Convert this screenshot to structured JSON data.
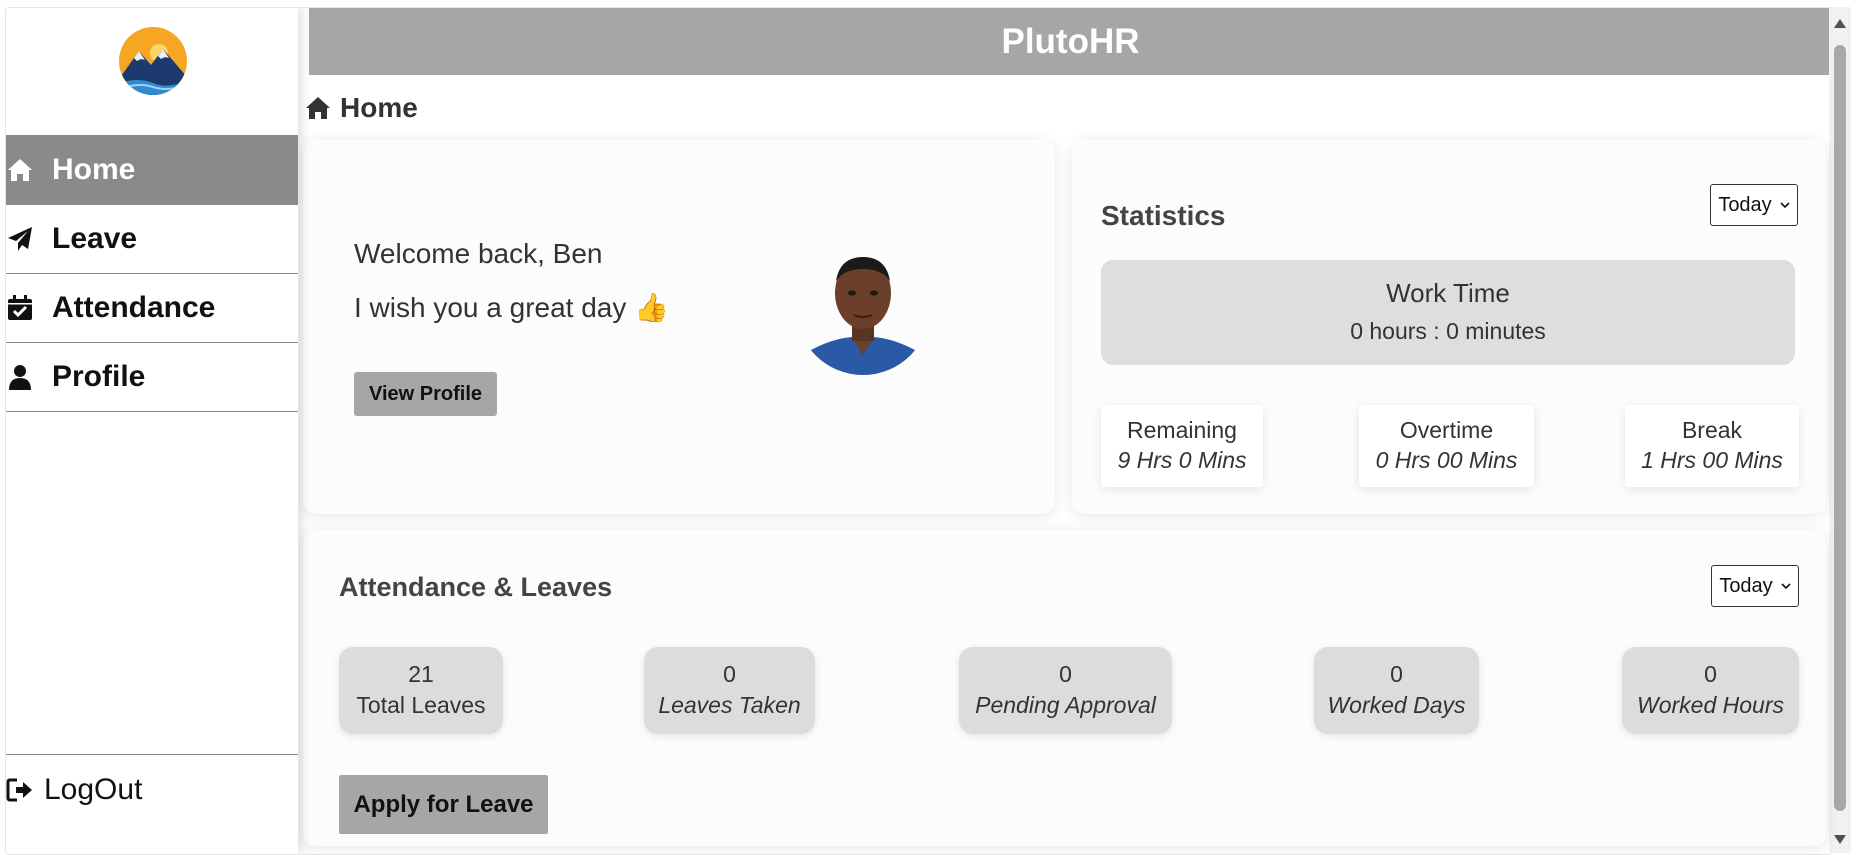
{
  "app": {
    "title": "PlutoHR"
  },
  "sidebar": {
    "items": [
      {
        "label": "Home",
        "icon": "home-icon",
        "active": true
      },
      {
        "label": "Leave",
        "icon": "paper-plane-icon",
        "active": false
      },
      {
        "label": "Attendance",
        "icon": "calendar-check-icon",
        "active": false
      },
      {
        "label": "Profile",
        "icon": "user-icon",
        "active": false
      }
    ],
    "logout_label": "LogOut"
  },
  "breadcrumb": {
    "label": "Home"
  },
  "welcome": {
    "greeting": "Welcome back, Ben",
    "wish": "I wish you a great day 👍",
    "view_profile_label": "View Profile"
  },
  "statistics": {
    "title": "Statistics",
    "period": "Today",
    "work_time_label": "Work Time",
    "work_time_value": "0 hours : 0 minutes",
    "remaining_label": "Remaining",
    "remaining_value": "9 Hrs 0 Mins",
    "overtime_label": "Overtime",
    "overtime_value": "0 Hrs 00 Mins",
    "break_label": "Break",
    "break_value": "1 Hrs 00 Mins"
  },
  "attendance": {
    "title": "Attendance & Leaves",
    "period": "Today",
    "total_leaves_value": "21",
    "total_leaves_label": "Total Leaves",
    "leaves_taken_value": "0",
    "leaves_taken_label": "Leaves Taken",
    "pending_value": "0",
    "pending_label": "Pending Approval",
    "worked_days_value": "0",
    "worked_days_label": "Worked Days",
    "worked_hours_value": "0",
    "worked_hours_label": "Worked Hours",
    "apply_label": "Apply for Leave"
  },
  "colors": {
    "header_bg": "#a7a6a7",
    "active_nav_bg": "#8a8a8a",
    "button_bg": "#a7a6a7",
    "panel_bg": "#dedede"
  }
}
